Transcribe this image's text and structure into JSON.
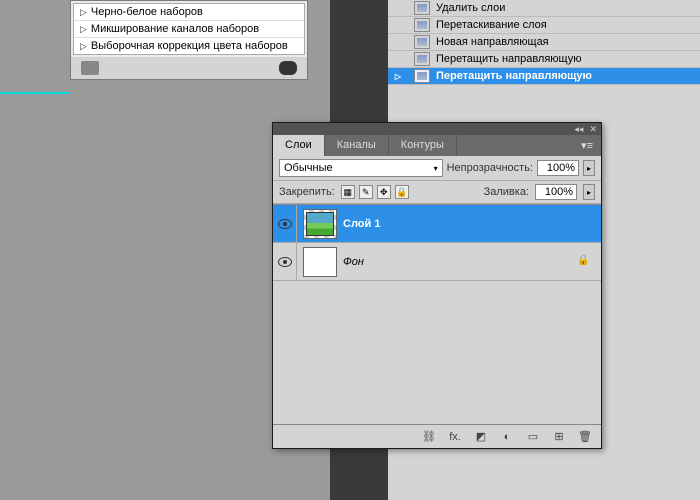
{
  "adjustments": {
    "items": [
      "Черно-белое наборов",
      "Микширование каналов наборов",
      "Выборочная коррекция цвета наборов"
    ]
  },
  "history": {
    "items": [
      {
        "label": "Удалить слои",
        "selected": false
      },
      {
        "label": "Перетаскивание слоя",
        "selected": false
      },
      {
        "label": "Новая направляющая",
        "selected": false
      },
      {
        "label": "Перетащить направляющую",
        "selected": false
      },
      {
        "label": "Перетащить направляющую",
        "selected": true
      }
    ]
  },
  "layers_panel": {
    "tabs": {
      "layers": "Слои",
      "channels": "Каналы",
      "paths": "Контуры"
    },
    "blend_mode": "Обычные",
    "opacity_label": "Непрозрачность:",
    "opacity_value": "100%",
    "lock_label": "Закрепить:",
    "fill_label": "Заливка:",
    "fill_value": "100%",
    "layers": [
      {
        "name": "Слой 1",
        "selected": true,
        "locked": false,
        "thumb": "img"
      },
      {
        "name": "Фон",
        "selected": false,
        "locked": true,
        "thumb": "white"
      }
    ],
    "footer_icons": {
      "link": "⌘",
      "fx": "fx.",
      "mask": "◐",
      "adjust": "◑.",
      "group": "▭",
      "new": "⊞",
      "trash": "🗑"
    }
  }
}
